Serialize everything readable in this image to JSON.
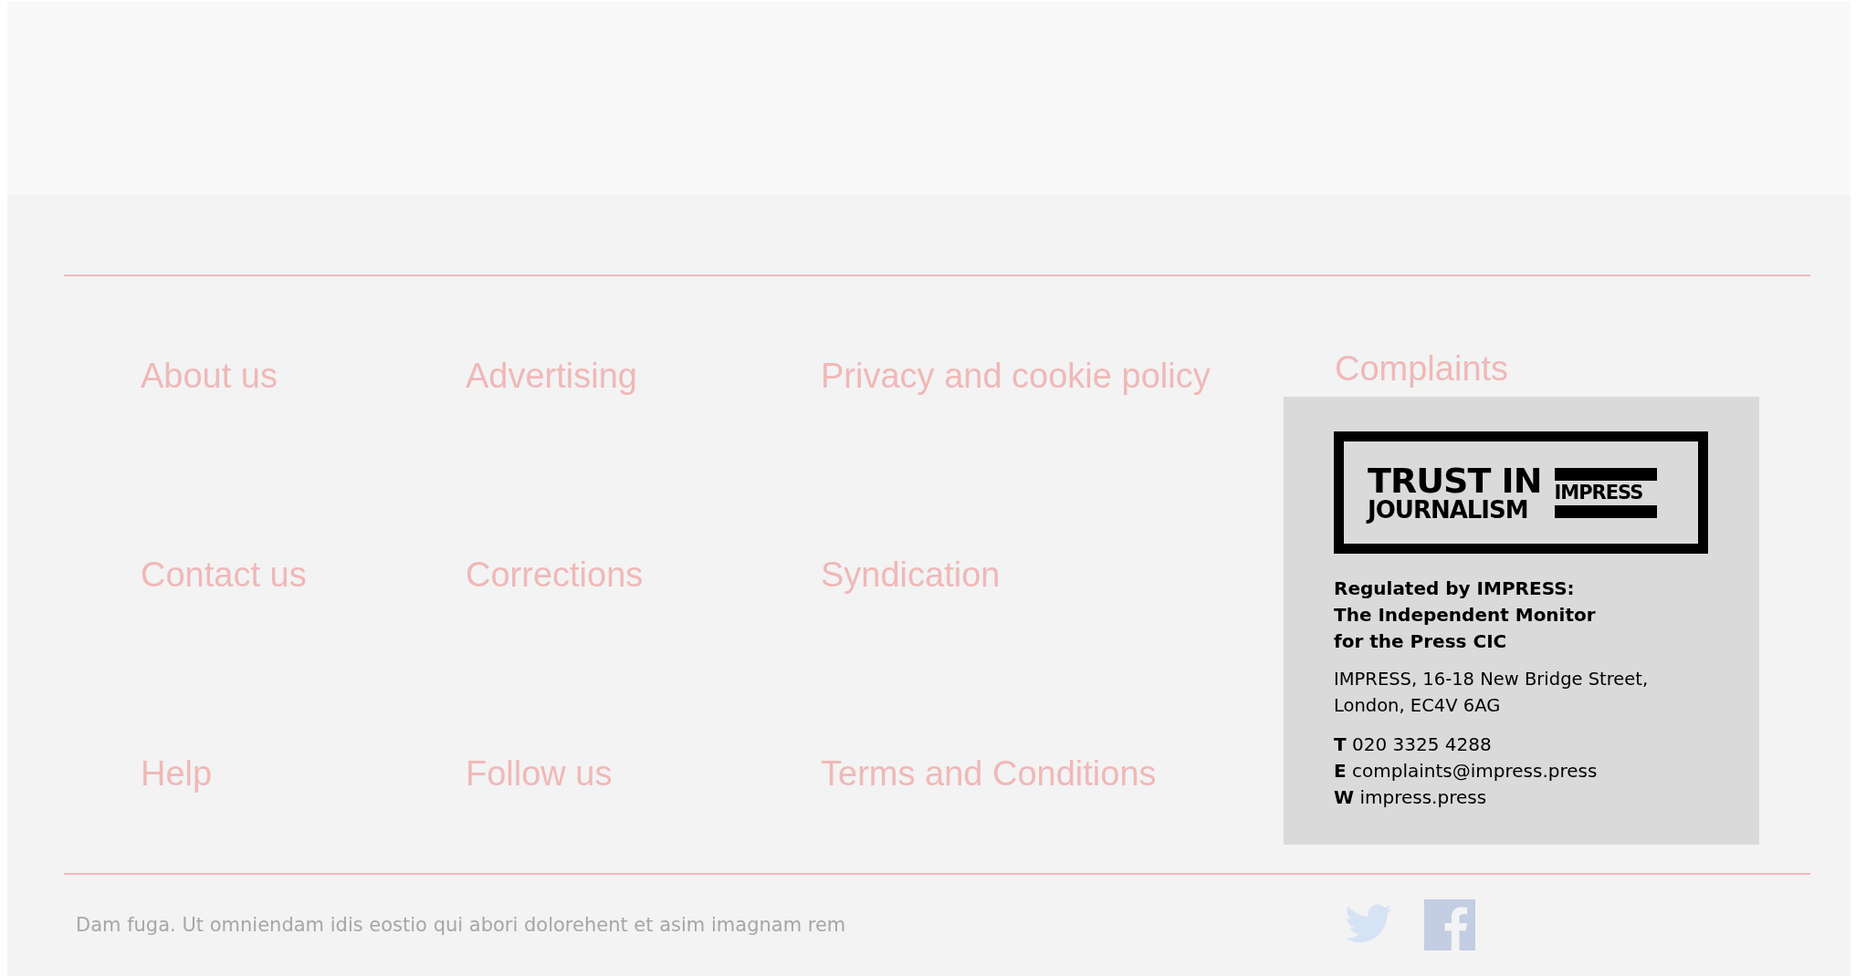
{
  "footer": {
    "links": [
      {
        "label": "About us"
      },
      {
        "label": "Advertising"
      },
      {
        "label": "Privacy and cookie policy"
      },
      {
        "label": "Contact us"
      },
      {
        "label": "Corrections"
      },
      {
        "label": "Syndication"
      },
      {
        "label": "Help"
      },
      {
        "label": "Follow us"
      },
      {
        "label": "Terms and Conditions"
      }
    ],
    "complaints": {
      "heading": "Complaints",
      "logo": {
        "line_1": "TRUST IN",
        "line_2": "JOURNALISM",
        "brand": "IMPRESS"
      },
      "regulated_by": [
        "Regulated by IMPRESS:",
        "The Independent Monitor",
        "for the Press CIC"
      ],
      "address": [
        "IMPRESS, 16-18 New Bridge Street,",
        "London, EC4V 6AG"
      ],
      "contacts": [
        "**T** 020 3325 4288",
        "**E** complaints@impress.press",
        "**W** impress.press"
      ]
    },
    "tagline": "Dam fuga. Ut omniendam idis eostio qui abori dolorehent et asim imagnam rem",
    "social": [
      {
        "kind": "twitter"
      },
      {
        "kind": "facebook"
      }
    ]
  }
}
